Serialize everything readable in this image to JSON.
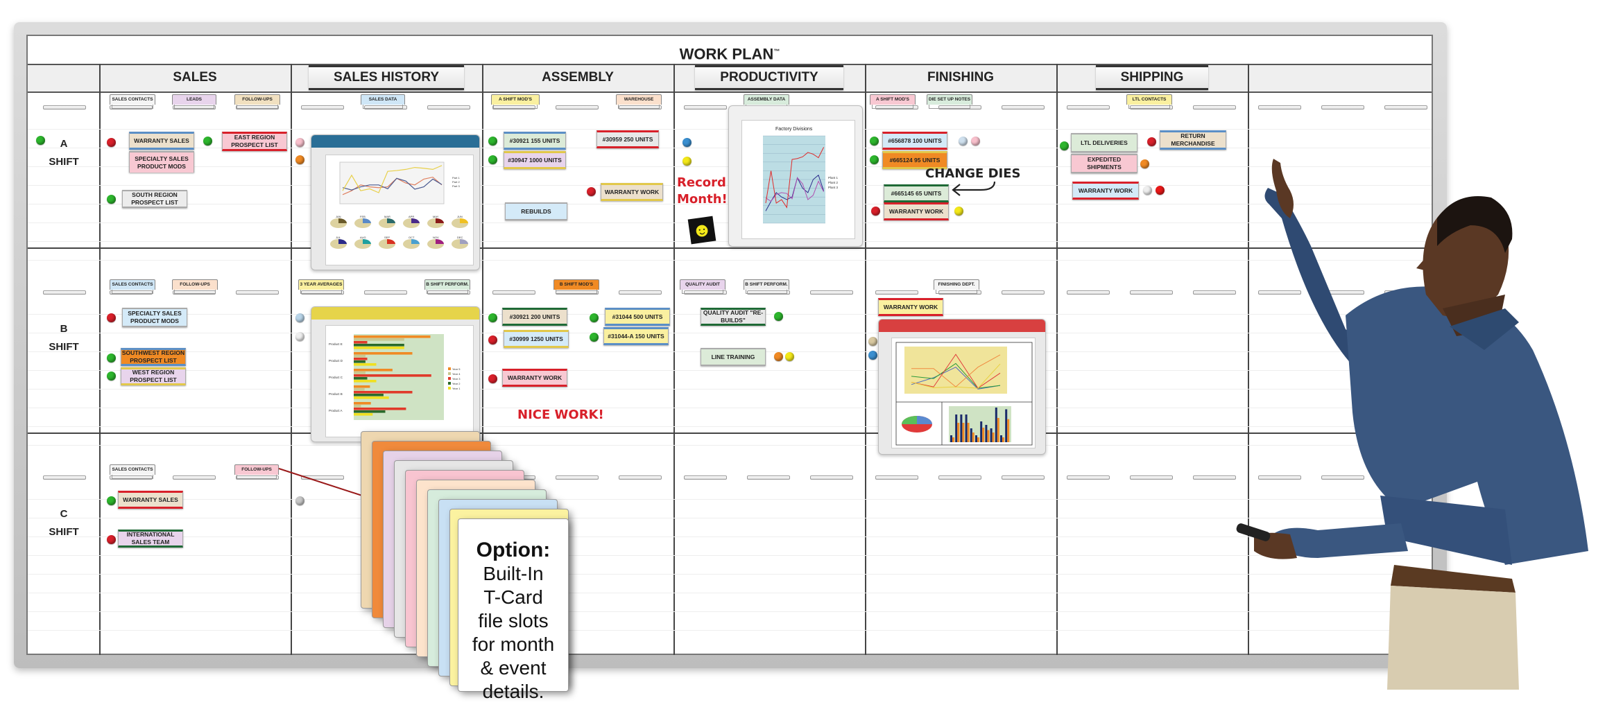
{
  "board": {
    "title": "WORK PLAN",
    "trademark": "™",
    "columns": [
      "",
      "SALES",
      "SALES HISTORY",
      "ASSEMBLY",
      "PRODUCTIVITY",
      "FINISHING",
      "SHIPPING",
      ""
    ],
    "rows": [
      {
        "letter": "A",
        "word": "SHIFT"
      },
      {
        "letter": "B",
        "word": "SHIFT"
      },
      {
        "letter": "C",
        "word": "SHIFT"
      }
    ]
  },
  "tabs": {
    "a_sales": [
      "SALES CONTACTS",
      "LEADS",
      "FOLLOW-UPS"
    ],
    "a_history": [
      "SALES DATA"
    ],
    "a_assembly": [
      "A SHIFT MOD'S",
      "WAREHOUSE"
    ],
    "a_productivity": [
      "ASSEMBLY DATA"
    ],
    "a_finishing": [
      "A SHIFT MOD'S",
      "DIE SET UP NOTES"
    ],
    "a_shipping": [
      "LTL CONTACTS"
    ],
    "b_sales": [
      "SALES CONTACTS",
      "FOLLOW-UPS"
    ],
    "b_history": [
      "3 YEAR AVERAGES",
      "B SHIFT PERFORM."
    ],
    "b_assembly": [
      "B SHIFT MOD'S"
    ],
    "b_productivity": [
      "QUALITY AUDIT",
      "B SHIFT PERFORM."
    ],
    "b_finishing": [
      "FINISHING DEPT."
    ],
    "c_sales": [
      "SALES CONTACTS",
      "FOLLOW-UPS"
    ]
  },
  "magnets": {
    "a_sales": [
      "WARRANTY SALES",
      "SPECIALTY SALES PRODUCT MODS",
      "EAST REGION PROSPECT LIST",
      "SOUTH REGION PROSPECT LIST"
    ],
    "a_assembly": [
      "#30921 155 UNITS",
      "#30947 1000 UNITS",
      "#30959 250 UNITS",
      "WARRANTY WORK",
      "REBUILDS"
    ],
    "a_finishing": [
      "#656878 100 UNITS",
      "#665124 95 UNITS",
      "#665145 65 UNITS",
      "WARRANTY WORK"
    ],
    "a_shipping": [
      "LTL DELIVERIES",
      "EXPEDITED SHIPMENTS",
      "RETURN MERCHANDISE",
      "WARRANTY WORK"
    ],
    "b_sales": [
      "SPECIALTY SALES PRODUCT MODS",
      "SOUTHWEST REGION PROSPECT LIST",
      "WEST REGION PROSPECT LIST"
    ],
    "b_assembly": [
      "#30921 200 UNITS",
      "#30999 1250 UNITS",
      "#31044 500 UNITS",
      "#31044-A 150 UNITS",
      "WARRANTY WORK"
    ],
    "b_productivity": [
      "QUALITY AUDIT \"RE-BUILDS\"",
      "LINE TRAINING"
    ],
    "b_finishing": [
      "WARRANTY WORK"
    ],
    "c_sales": [
      "WARRANTY SALES",
      "INTERNATIONAL SALES TEAM"
    ]
  },
  "annotations": {
    "record_month": "Record Month!",
    "change_dies": "CHANGE DIES",
    "nice_work": "NICE WORK!"
  },
  "charts": {
    "sales_history": {
      "legend": [
        "Part 1",
        "Part 2",
        "Part 3"
      ],
      "months": [
        "JAN",
        "FEB",
        "MAR",
        "APR",
        "MAY",
        "JUN",
        "JUL",
        "AUG",
        "SEP",
        "OCT",
        "NOV",
        "DEC"
      ]
    },
    "factory": {
      "title": "Factory Divisions",
      "legend": [
        "Plant 1",
        "Plant 2",
        "Plant 3"
      ]
    },
    "averages": {
      "categories": [
        "Product E",
        "Product D",
        "Product C",
        "Product B",
        "Product A"
      ],
      "legend": [
        "Year 5",
        "Year 4",
        "Year 3",
        "Year 2",
        "Year 1"
      ]
    }
  },
  "callout": {
    "title": "Option:",
    "lines": [
      "Built-In",
      "T-Card",
      "file slots",
      "for month",
      "& event",
      "details."
    ]
  },
  "colors": {
    "green": "#2db52d",
    "red": "#d8202a",
    "blue": "#3a8fd0",
    "yellow": "#f3e81a",
    "orange": "#f08a24",
    "pink": "#f5b8c8"
  }
}
